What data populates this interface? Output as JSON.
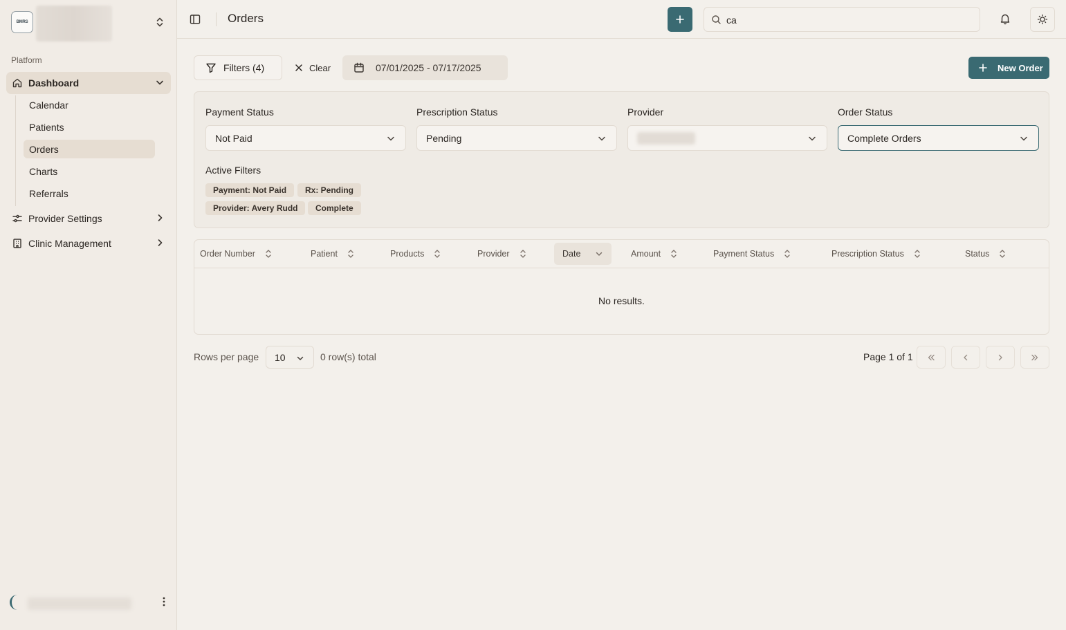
{
  "sidebar": {
    "org_logo_text": "BMRS",
    "section_label": "Platform",
    "items": [
      {
        "label": "Dashboard",
        "icon": "home-icon"
      },
      {
        "label": "Provider Settings",
        "icon": "sliders-icon"
      },
      {
        "label": "Clinic Management",
        "icon": "building-icon"
      }
    ],
    "subitems": [
      {
        "label": "Calendar"
      },
      {
        "label": "Patients"
      },
      {
        "label": "Orders"
      },
      {
        "label": "Charts"
      },
      {
        "label": "Referrals"
      }
    ]
  },
  "header": {
    "title": "Orders",
    "search_value": "ca"
  },
  "toolbar": {
    "filters_label": "Filters (4)",
    "clear_label": "Clear",
    "date_range": "07/01/2025 - 07/17/2025",
    "new_order_label": "New Order"
  },
  "filters": {
    "payment_status": {
      "label": "Payment Status",
      "value": "Not Paid"
    },
    "prescription_status": {
      "label": "Prescription Status",
      "value": "Pending"
    },
    "provider": {
      "label": "Provider",
      "value": ""
    },
    "order_status": {
      "label": "Order Status",
      "value": "Complete Orders"
    },
    "active_label": "Active Filters",
    "chips": [
      "Payment: Not Paid",
      "Rx: Pending",
      "Provider: Avery Rudd",
      "Complete"
    ]
  },
  "table": {
    "columns": [
      "Order Number",
      "Patient",
      "Products",
      "Provider",
      "Date",
      "Amount",
      "Payment Status",
      "Prescription Status",
      "Status"
    ],
    "empty_text": "No results."
  },
  "pagination": {
    "rows_per_page_label": "Rows per page",
    "rows_per_page_value": "10",
    "row_total": "0 row(s) total",
    "page_info": "Page 1 of 1"
  },
  "colors": {
    "accent": "#3a6a72",
    "background": "#f3f0eb",
    "active_nav": "#e6ddd2"
  }
}
